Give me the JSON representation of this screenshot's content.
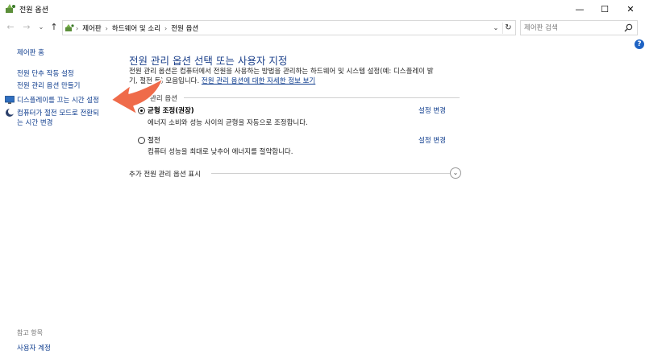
{
  "window": {
    "title": "전원 옵션",
    "minimize_glyph": "—",
    "maximize_glyph": "☐",
    "close_glyph": "✕"
  },
  "nav": {
    "back_glyph": "←",
    "forward_glyph": "→",
    "recent_glyph": "⌄",
    "up_glyph": "↑"
  },
  "address": {
    "crumbs": [
      "제어판",
      "하드웨어 및 소리",
      "전원 옵션"
    ],
    "separator": "›",
    "dropdown_glyph": "⌄",
    "refresh_glyph": "↻"
  },
  "search": {
    "placeholder": "제어판 검색"
  },
  "help": {
    "glyph": "?"
  },
  "sidebar": {
    "home_label": "제어판 홈",
    "links": [
      "전원 단추 작동 설정",
      "전원 관리 옵션 만들기",
      "디스플레이를 끄는 시간 설정",
      "컴퓨터가 절전 모드로 전환되",
      "는 시간 변경"
    ],
    "see_also_heading": "참고 항목",
    "see_also_link": "사용자 계정"
  },
  "main": {
    "title": "전원 관리 옵션 선택 또는 사용자 지정",
    "description_line1": "전원 관리 옵션은 컴퓨터에서 전원을 사용하는 방법을 관리하는 하드웨어 및 시스템 설정(예: 디스플레이 밝",
    "description_line2": "기, 절전 등) 모음입니다.",
    "description_link": "전원 관리 옵션에 대한 자세한 정보 보기",
    "section_label": "관리 옵션",
    "plans": [
      {
        "name": "균형 조정(권장)",
        "description": "에너지 소비와 성능 사이의 균형을 자동으로 조정합니다.",
        "link": "설정 변경",
        "selected": true
      },
      {
        "name": "절전",
        "description": "컴퓨터 성능을 최대로 낮추어 에너지를 절약합니다.",
        "link": "설정 변경",
        "selected": false
      }
    ],
    "more_label": "추가 전원 관리 옵션 표시",
    "more_glyph": "⌄"
  },
  "colors": {
    "link": "#0b3a8c",
    "title": "#1a3f8a",
    "callout": "#ef6b4a"
  }
}
